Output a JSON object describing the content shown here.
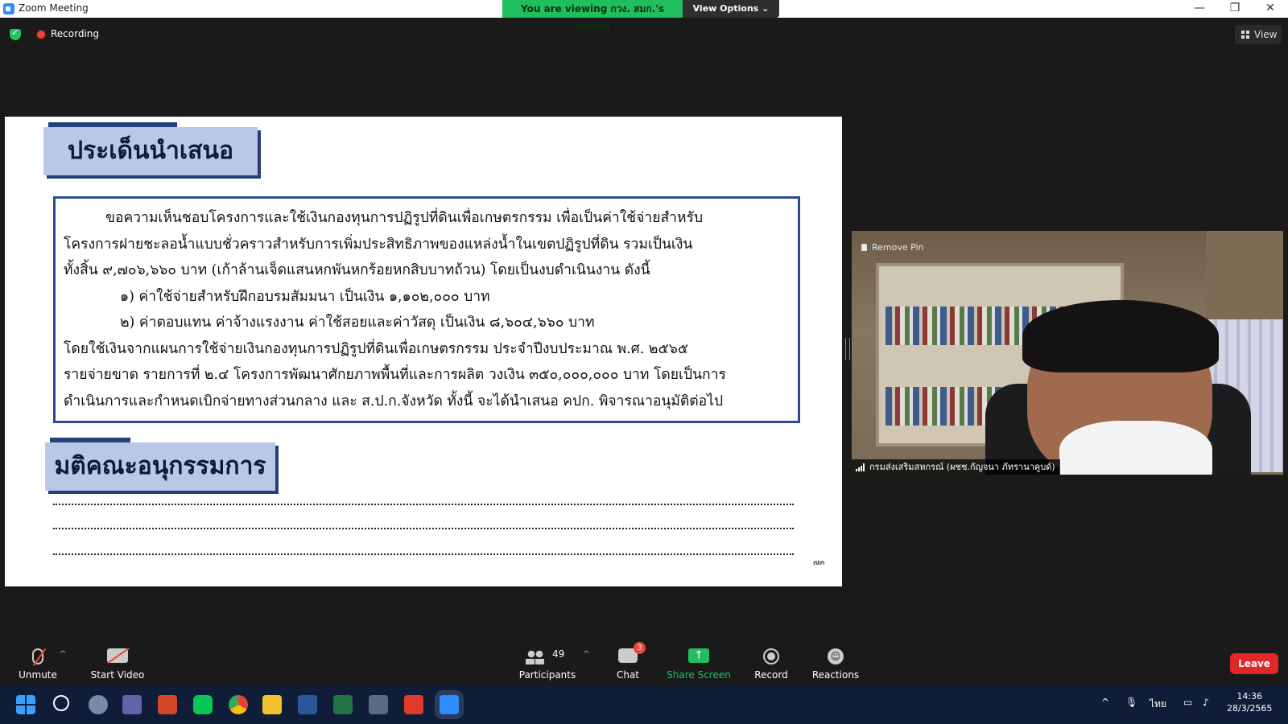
{
  "window": {
    "title": "Zoom Meeting",
    "viewing_banner": "You are viewing กวง. สมก.'s screen",
    "view_options": "View Options ⌄",
    "minimize": "—",
    "maximize": "❐",
    "close": "✕"
  },
  "top_bar": {
    "recording_label": "Recording",
    "view_label": "View"
  },
  "slide": {
    "heading_1": "ประเด็นนำเสนอ",
    "paragraph_lines": [
      "ขอความเห็นชอบโครงการและใช้เงินกองทุนการปฏิรูปที่ดินเพื่อเกษตรกรรม เพื่อเป็นค่าใช้จ่ายสำหรับ",
      "โครงการฝายชะลอน้ำแบบชั่วคราวสำหรับการเพิ่มประสิทธิภาพของแหล่งน้ำในเขตปฏิรูปที่ดิน รวมเป็นเงิน",
      "ทั้งสิ้น ๙,๗๐๖,๖๖๐ บาท (เก้าล้านเจ็ดแสนหกพันหกร้อยหกสิบบาทถ้วน) โดยเป็นงบดำเนินงาน ดังนี้",
      "๑) ค่าใช้จ่ายสำหรับฝึกอบรมสัมมนา เป็นเงิน ๑,๑๐๒,๐๐๐ บาท",
      "๒) ค่าตอบแทน ค่าจ้างแรงงาน ค่าใช้สอยและค่าวัสดุ เป็นเงิน ๘,๖๐๔,๖๖๐ บาท",
      "โดยใช้เงินจากแผนการใช้จ่ายเงินกองทุนการปฏิรูปที่ดินเพื่อเกษตรกรรม ประจำปีงบประมาณ พ.ศ. ๒๕๖๕",
      "รายจ่ายขาด รายการที่ ๒.๔ โครงการพัฒนาศักยภาพพื้นที่และการผลิต วงเงิน ๓๕๐,๐๐๐,๐๐๐ บาท โดยเป็นการ",
      "ดำเนินการและกำหนดเบิกจ่ายทางส่วนกลาง และ ส.ป.ก.จังหวัด ทั้งนี้ จะได้นำเสนอ คปก. พิจารณาอนุมัติต่อไป"
    ],
    "heading_2": "มติคณะอนุกรรมการ",
    "page_number": "๗๓"
  },
  "video": {
    "remove_pin": "Remove Pin",
    "participant_name": "กรมส่งเสริมสหกรณ์ (ผชช.กัญจนา ภัทรานาคูบด์)"
  },
  "controls": {
    "unmute": "Unmute",
    "start_video": "Start Video",
    "participants_count": "49",
    "participants": "Participants",
    "chat": "Chat",
    "chat_badge": "3",
    "share_screen": "Share Screen",
    "record": "Record",
    "reactions": "Reactions",
    "leave": "Leave"
  },
  "taskbar": {
    "language": "ไทย",
    "time": "14:36",
    "date": "28/3/2565"
  },
  "colors": {
    "banner_green": "#1fbf5d",
    "slide_border_blue": "#2a4b94",
    "heading_fill": "#b8c8e6",
    "leave_red": "#e02828",
    "taskbar": "#0f1d38"
  }
}
